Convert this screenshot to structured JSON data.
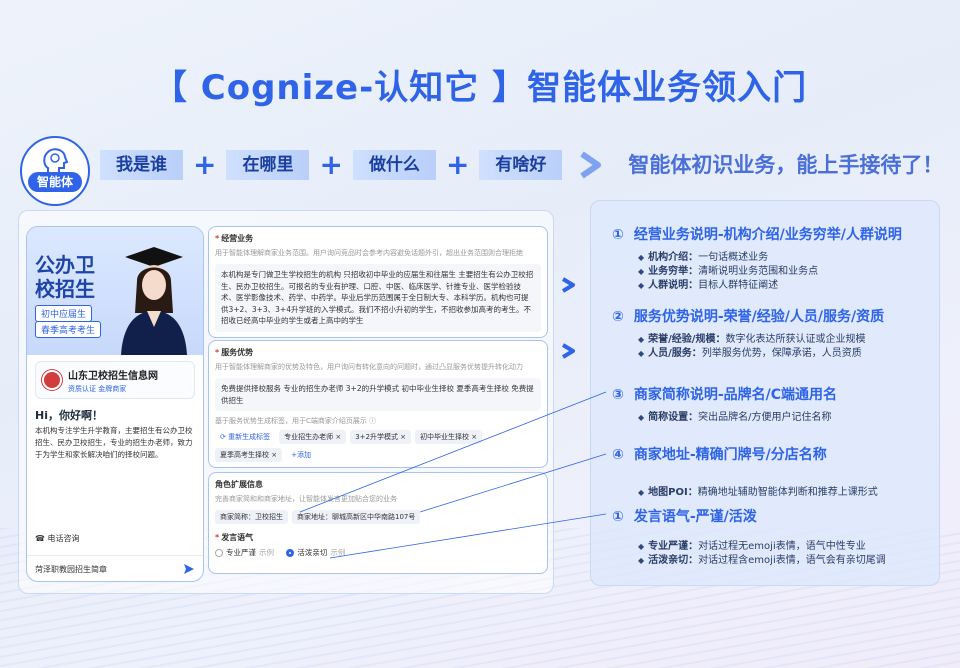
{
  "title": "【 Cognize-认知它 】智能体业务领入门",
  "badge_label": "智能体",
  "tags": [
    "我是谁",
    "在哪里",
    "做什么",
    "有啥好"
  ],
  "plus": "+",
  "slogan": "智能体初识业务，能上手接待了！",
  "phone": {
    "headline_1": "公办卫",
    "headline_2": "校招生",
    "pill_1": "初中应届生",
    "pill_2": "春季高考考生",
    "org_name": "山东卫校招生信息网",
    "org_sub": "资质认证 金牌商家",
    "greeting": "Hi，你好啊！",
    "intro": "本机构专注学生升学教育，主要招生有公办卫校招生、民办卫校招生，专业的招生办老师，致力于为学生和家长解决咱们的择校问题。",
    "consult": "电话咨询",
    "input": "菏泽职教园招生简章"
  },
  "form1": {
    "title": "经营业务",
    "hint": "用于智能体理解商家业务范围。用户询问竞品时会参考内容避免话题外引，超出业务范围则合理拒绝",
    "body": "本机构是专门做卫生学校招生的机构 只招收初中毕业的应届生和往届生 主要招生有公办卫校招生、民办卫校招生。可报名的专业有护理、口腔、中医、临床医学、针推专业、医学检验技术、医学影像技术、药学、中药学。毕业后学历范围属于全日制大专、本科学历。机构也可提供3+2、3+3、3+4升学班的入学模式。我们不招小升初的学生，不招收参加高考的考生。不招收已经高中毕业的学生或者上高中的学生"
  },
  "form2": {
    "title": "服务优势",
    "hint": "用于智能体理解商家的优势及特色，用户询问有转化意向的问题时，通过凸显服务优势提升转化动力",
    "body": "免费提供择校服务 专业的招生办老师 3+2的升学模式 初中毕业生择校 夏季高考生择校 免费提供招生",
    "tag_hint": "基于服务优势生成标签，用于C端商家介绍页展示 ⓘ",
    "regen": "重新生成标签",
    "chips": [
      "专业招生办老师 ×",
      "3+2升学模式 ×",
      "初中毕业生择校 ×",
      "夏季高考生择校 ×"
    ],
    "add": "+添加"
  },
  "form3": {
    "title": "角色扩展信息",
    "hint": "完善商家简和和商家地址，让智能体发言更加贴合您的业务",
    "short_name": "商家简称：卫校招生",
    "address": "商家地址：聊城高新区中华南路107号",
    "speech_title": "发言语气",
    "opt1": "专业严谨",
    "opt2": "活泼亲切",
    "ex": "示例"
  },
  "sections": [
    {
      "num": "①",
      "head": "经营业务说明-机构介绍/业务穷举/人群说明",
      "items": [
        [
          "机构介绍：",
          "一句话概述业务"
        ],
        [
          "业务穷举：",
          "清晰说明业务范围和业务点"
        ],
        [
          "人群说明：",
          "目标人群特征阐述"
        ]
      ]
    },
    {
      "num": "②",
      "head": "服务优势说明-荣誉/经验/人员/服务/资质",
      "items": [
        [
          "荣誉/经验/规模：",
          "数字化表达所获认证或企业规模"
        ],
        [
          "人员/服务：",
          "列举服务优势，保障承诺，人员资质"
        ]
      ]
    },
    {
      "num": "③",
      "head": "商家简称说明-品牌名/C端通用名",
      "items": [
        [
          "简称设置：",
          "突出品牌名/方便用户记住名称"
        ]
      ]
    },
    {
      "num": "④",
      "head": "商家地址-精确门牌号/分店名称",
      "items": [
        [
          "地图POI：",
          "精确地址辅助智能体判断和推荐上课形式"
        ]
      ]
    },
    {
      "num": "①",
      "head": "发言语气-严谨/活泼",
      "items": [
        [
          "专业严谨：",
          "对话过程无emoji表情，语气中性专业"
        ],
        [
          "活泼亲切：",
          "对话过程含emoji表情，语气会有亲切尾调"
        ]
      ]
    }
  ],
  "colors": {
    "accent": "#2f64e8",
    "panel": "#dce8fc"
  }
}
